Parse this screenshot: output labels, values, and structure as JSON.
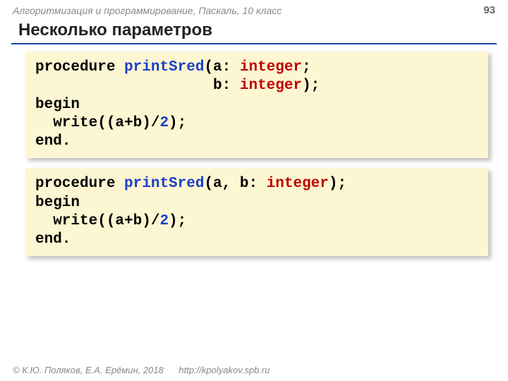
{
  "header": {
    "course": "Алгоритмизация и программирование, Паскаль, 10 класс",
    "page": "93"
  },
  "title": "Несколько параметров",
  "code1": {
    "l1a": "procedure ",
    "l1b": "printSred",
    "l1c": "(a: ",
    "l1d": "integer",
    "l1e": ";",
    "l2a": "                    b: ",
    "l2b": "integer",
    "l2c": ");",
    "l3": "begin",
    "l4a": "  write((a+b)/",
    "l4b": "2",
    "l4c": ");",
    "l5": "end."
  },
  "code2": {
    "l1a": "procedure ",
    "l1b": "printSred",
    "l1c": "(a, b: ",
    "l1d": "integer",
    "l1e": ");",
    "l2": "begin",
    "l3a": "  write((a+b)/",
    "l3b": "2",
    "l3c": ");",
    "l4": "end."
  },
  "footer": {
    "copyright": "© К.Ю. Поляков, Е.А. Ерёмин, 2018",
    "url": "http://kpolyakov.spb.ru"
  }
}
